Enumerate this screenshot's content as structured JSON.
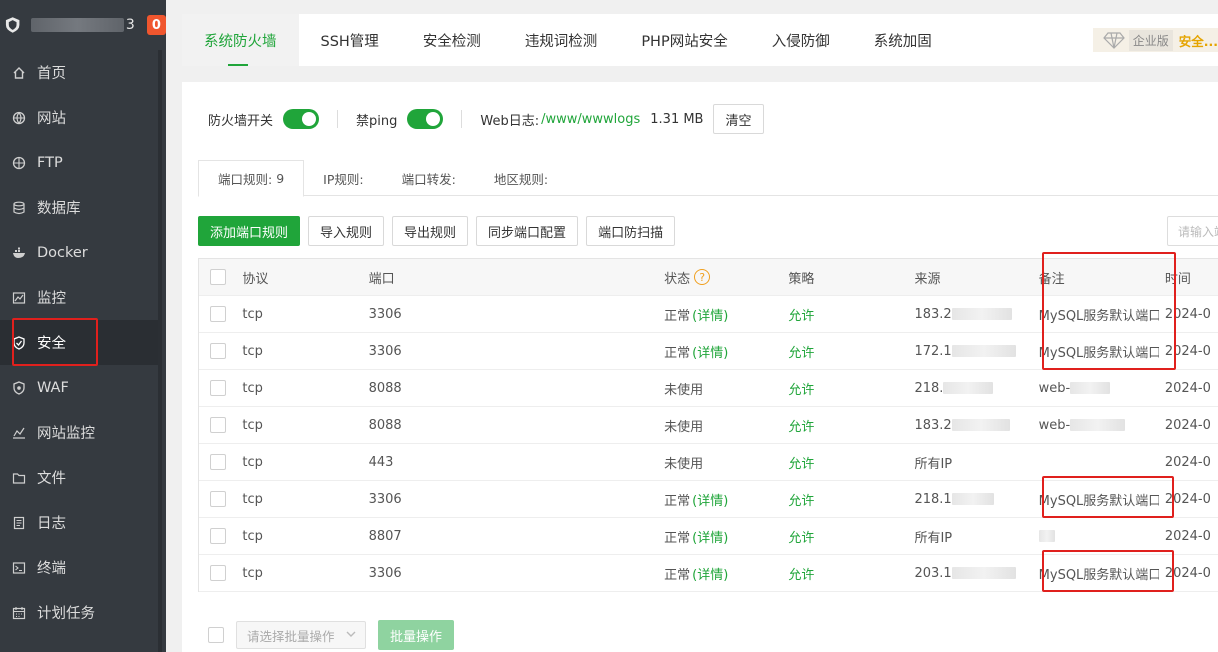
{
  "sidebar": {
    "host_tail": "3",
    "badge": "0",
    "items": [
      {
        "label": "首页",
        "icon": "home-icon"
      },
      {
        "label": "网站",
        "icon": "globe-icon"
      },
      {
        "label": "FTP",
        "icon": "ftp-icon"
      },
      {
        "label": "数据库",
        "icon": "database-icon"
      },
      {
        "label": "Docker",
        "icon": "docker-icon"
      },
      {
        "label": "监控",
        "icon": "monitor-icon"
      },
      {
        "label": "安全",
        "icon": "shield-icon"
      },
      {
        "label": "WAF",
        "icon": "waf-icon"
      },
      {
        "label": "网站监控",
        "icon": "site-monitor-icon"
      },
      {
        "label": "文件",
        "icon": "folder-icon"
      },
      {
        "label": "日志",
        "icon": "log-icon"
      },
      {
        "label": "终端",
        "icon": "terminal-icon"
      },
      {
        "label": "计划任务",
        "icon": "calendar-icon"
      }
    ]
  },
  "topbar": {
    "tabs": [
      "系统防火墙",
      "SSH管理",
      "安全检测",
      "违规词检测",
      "PHP网站安全",
      "入侵防御",
      "系统加固"
    ],
    "enterprise_label": "企业版",
    "enterprise_link": "安全..."
  },
  "toolbar": {
    "firewall_switch": "防火墙开关",
    "ping_label": "禁ping",
    "weblog_label": "Web日志:",
    "weblog_path": "/www/wwwlogs",
    "weblog_size": "1.31 MB",
    "clear_button": "清空"
  },
  "subtabs": {
    "port_rules": "端口规则:",
    "port_rules_count": "9",
    "ip_rules": "IP规则:",
    "port_forward": "端口转发:",
    "region_rules": "地区规则:"
  },
  "actions": {
    "add": "添加端口规则",
    "import": "导入规则",
    "export": "导出规则",
    "sync": "同步端口配置",
    "scan": "端口防扫描",
    "search_placeholder": "请输入端口"
  },
  "table": {
    "headers": {
      "protocol": "协议",
      "port": "端口",
      "status": "状态",
      "policy": "策略",
      "source": "来源",
      "note": "备注",
      "time": "时间"
    },
    "rows": [
      {
        "protocol": "tcp",
        "port": "3306",
        "status": "正常",
        "detail": "(详情)",
        "policy": "允许",
        "source": "183.2",
        "note": "MySQL服务默认端口",
        "time": "2024-0"
      },
      {
        "protocol": "tcp",
        "port": "3306",
        "status": "正常",
        "detail": "(详情)",
        "policy": "允许",
        "source": "172.1",
        "note": "MySQL服务默认端口",
        "time": "2024-0"
      },
      {
        "protocol": "tcp",
        "port": "8088",
        "status": "未使用",
        "detail": "",
        "policy": "允许",
        "source": "218.",
        "note": "web-",
        "time": "2024-0"
      },
      {
        "protocol": "tcp",
        "port": "8088",
        "status": "未使用",
        "detail": "",
        "policy": "允许",
        "source": "183.2",
        "note": "web-",
        "time": "2024-0"
      },
      {
        "protocol": "tcp",
        "port": "443",
        "status": "未使用",
        "detail": "",
        "policy": "允许",
        "source": "所有IP",
        "note": "",
        "time": "2024-0"
      },
      {
        "protocol": "tcp",
        "port": "3306",
        "status": "正常",
        "detail": "(详情)",
        "policy": "允许",
        "source": "218.1",
        "note": "MySQL服务默认端口",
        "time": "2024-0"
      },
      {
        "protocol": "tcp",
        "port": "8807",
        "status": "正常",
        "detail": "(详情)",
        "policy": "允许",
        "source": "所有IP",
        "note": "",
        "time": "2024-0"
      },
      {
        "protocol": "tcp",
        "port": "3306",
        "status": "正常",
        "detail": "(详情)",
        "policy": "允许",
        "source": "203.1",
        "note": "MySQL服务默认端口",
        "time": "2024-0"
      }
    ]
  },
  "bottom": {
    "batch_select": "请选择批量操作",
    "batch_button": "批量操作"
  },
  "colors": {
    "accent": "#20a53a",
    "sidebar": "#353a40",
    "highlight": "#e0201d",
    "badge": "#f0562e"
  }
}
